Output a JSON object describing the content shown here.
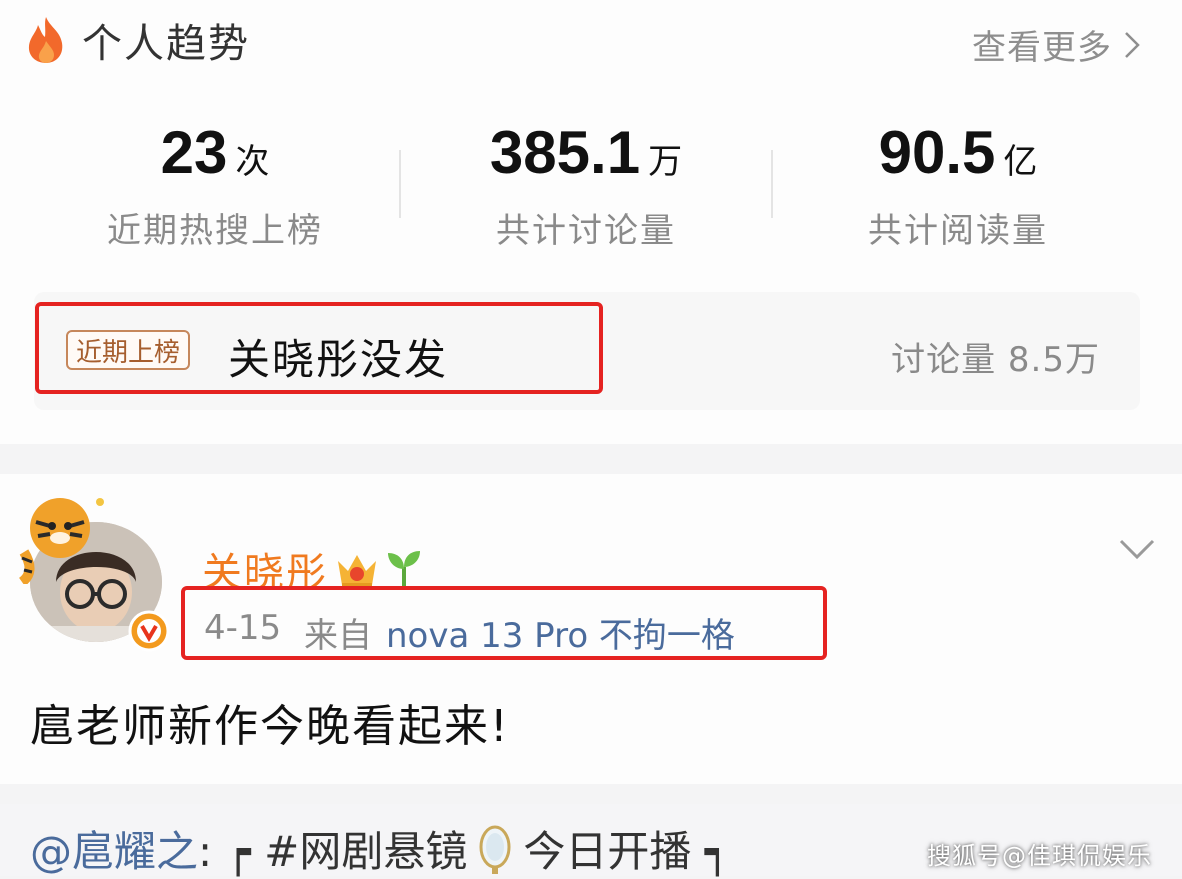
{
  "colors": {
    "accent_orange": "#f07a1f",
    "highlight_red": "#e52321",
    "link_blue": "#4a6b9c",
    "muted_gray": "#8a8a8a"
  },
  "trend_section": {
    "icon": "flame-icon",
    "title": "个人趋势",
    "see_more": "查看更多",
    "stats": [
      {
        "value": "23",
        "unit": "次",
        "label": "近期热搜上榜"
      },
      {
        "value": "385.1",
        "unit": "万",
        "label": "共计讨论量"
      },
      {
        "value": "90.5",
        "unit": "亿",
        "label": "共计阅读量"
      }
    ],
    "recent": {
      "badge": "近期上榜",
      "topic": "关晓彤没发",
      "discussion": "讨论量 8.5万"
    }
  },
  "post": {
    "user_name": "关晓彤",
    "date": "4-15",
    "source_prefix": "来自",
    "source": "nova 13 Pro 不拘一格",
    "text": "扈老师新作今晚看起来!"
  },
  "repost": {
    "mention": "@扈耀之",
    "text_before": ": ┍ #网剧悬镜",
    "text_after": "今日开播 ┑"
  },
  "watermark": "搜狐号@佳琪侃娱乐"
}
